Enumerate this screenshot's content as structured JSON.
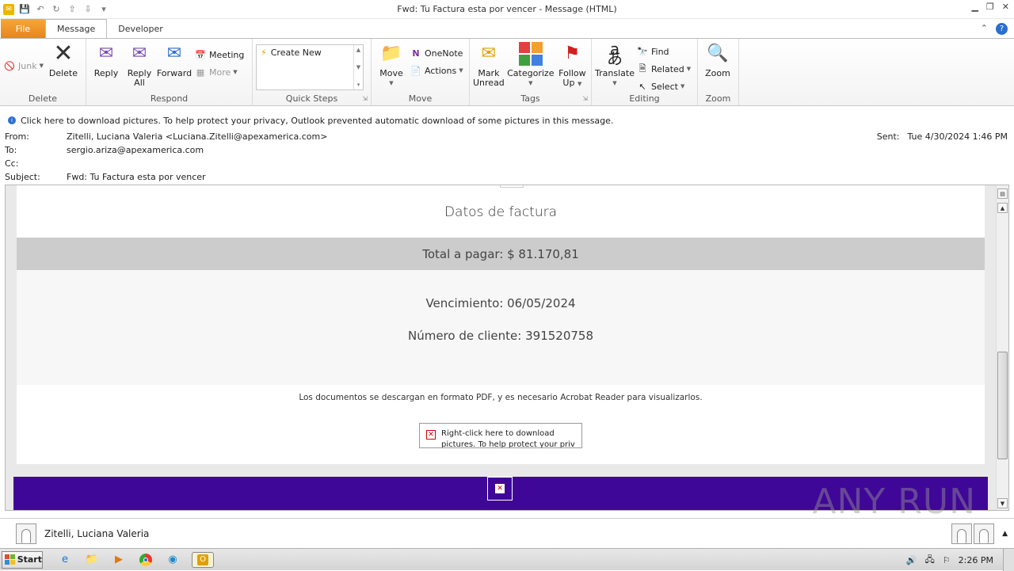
{
  "window": {
    "title": "Fwd: Tu Factura esta por vencer  -  Message (HTML)"
  },
  "tabs": [
    {
      "label": "File"
    },
    {
      "label": "Message"
    },
    {
      "label": "Developer"
    }
  ],
  "ribbon": {
    "delete_group": {
      "label": "Delete",
      "junk": "Junk",
      "delete": "Delete"
    },
    "respond_group": {
      "label": "Respond",
      "reply": "Reply",
      "reply_all_1": "Reply",
      "reply_all_2": "All",
      "forward": "Forward",
      "meeting": "Meeting",
      "more": "More"
    },
    "quick_steps_group": {
      "label": "Quick Steps",
      "create_new": "Create New"
    },
    "move_group": {
      "label": "Move",
      "move": "Move",
      "onenote": "OneNote",
      "actions": "Actions"
    },
    "tags_group": {
      "label": "Tags",
      "mark_unread_1": "Mark",
      "mark_unread_2": "Unread",
      "categorize": "Categorize",
      "follow_up_1": "Follow",
      "follow_up_2": "Up"
    },
    "editing_group": {
      "label": "Editing",
      "translate": "Translate",
      "find": "Find",
      "related": "Related",
      "select": "Select"
    },
    "zoom_group": {
      "label": "Zoom",
      "zoom": "Zoom"
    }
  },
  "infobar": {
    "text": "Click here to download pictures. To help protect your privacy, Outlook prevented automatic download of some pictures in this message."
  },
  "header": {
    "from_label": "From:",
    "from_value": "Zitelli, Luciana Valeria <Luciana.Zitelli@apexamerica.com>",
    "to_label": "To:",
    "to_value": "sergio.ariza@apexamerica.com",
    "cc_label": "Cc:",
    "cc_value": "",
    "subject_label": "Subject:",
    "subject_value": "Fwd: Tu Factura esta por vencer",
    "sent_label": "Sent:",
    "sent_value": "Tue 4/30/2024 1:46 PM"
  },
  "message": {
    "heading": "Datos de factura",
    "total": "Total a pagar:  $ 81.170,81",
    "due": "Vencimiento: 06/05/2024",
    "client": "Número de cliente: 391520758",
    "docs_note": "Los documentos se descargan en formato PDF, y es necesario Acrobat Reader para visualizarlos.",
    "broken_image_text": "Right-click here to download pictures.  To help protect your priv"
  },
  "watermark": "ANY RUN",
  "people_pane": {
    "name": "Zitelli, Luciana Valeria"
  },
  "taskbar": {
    "start": "Start",
    "clock": "2:26 PM"
  }
}
